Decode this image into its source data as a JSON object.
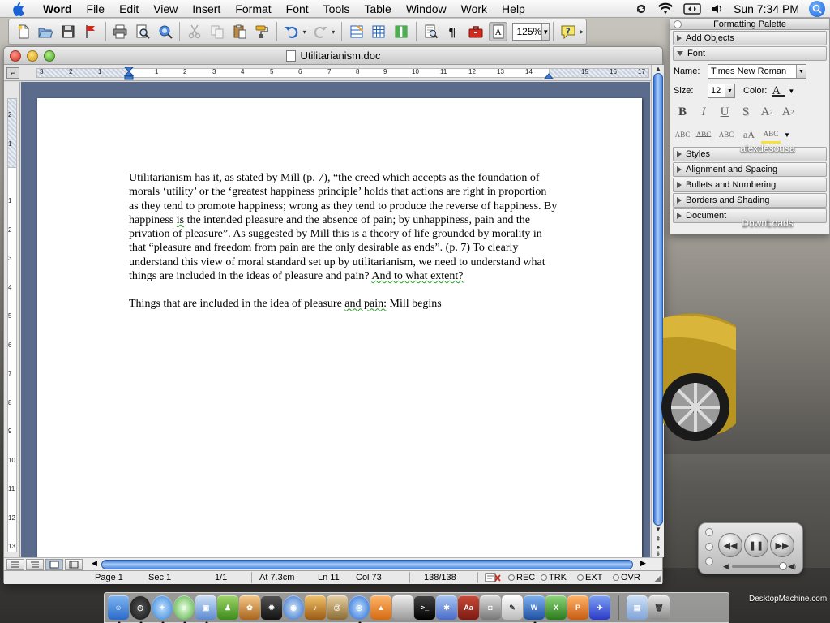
{
  "menubar": {
    "app_name": "Word",
    "menus": [
      "File",
      "Edit",
      "View",
      "Insert",
      "Format",
      "Font",
      "Tools",
      "Table",
      "Window",
      "Work",
      "Help"
    ],
    "clock": "Sun 7:34 PM",
    "icons": [
      "apple-icon",
      "sync-icon",
      "wifi-icon",
      "display-icon",
      "volume-icon",
      "spotlight-icon"
    ]
  },
  "toolbar": {
    "zoom": "125%",
    "icons": [
      "new-document-icon",
      "open-icon",
      "save-icon",
      "flag-icon",
      "print-icon",
      "print-preview-icon",
      "web-preview-icon",
      "cut-icon",
      "copy-icon",
      "paste-icon",
      "format-painter-icon",
      "undo-icon",
      "redo-icon",
      "tables-borders-icon",
      "insert-table-icon",
      "columns-icon",
      "document-map-icon",
      "show-formatting-icon",
      "toolbox-icon",
      "formatting-palette-icon",
      "help-icon",
      "more-icon"
    ]
  },
  "window": {
    "title": "Utilitarianism.doc",
    "ruler_h": [
      "3",
      "2",
      "1",
      "1",
      "2",
      "3",
      "4",
      "5",
      "6",
      "7",
      "8",
      "9",
      "10",
      "11",
      "12",
      "13",
      "14",
      "15",
      "16",
      "17"
    ],
    "ruler_v": [
      "2",
      "1",
      "1",
      "2",
      "3",
      "4",
      "5",
      "6",
      "7",
      "8",
      "9",
      "10",
      "11",
      "12",
      "13"
    ]
  },
  "document": {
    "paragraph1_parts": [
      "Utilitarianism has it, as stated by Mill (p. 7), “the creed which accepts as the foundation of morals ‘utility’ or the ‘greatest happiness principle’ holds that actions are right in proportion as they tend to promote happiness; wrong as they tend to produce the reverse of happiness. By happiness ",
      "is",
      " the intended pleasure and the absence of pain; by unhappiness, pain and the privation of pleasure”. As suggested by Mill this is a theory of life grounded by morality in that “pleasure and freedom from pain are the only desirable as ends”. (p. 7) To clearly understand this view of moral standard set up by utilitarianism, we need to understand what things are included in the ideas of pleasure and pain? ",
      "And to what extent?"
    ],
    "paragraph2_parts": [
      "Things that are included in the idea of pleasure ",
      "and  pain:",
      " Mill begins"
    ]
  },
  "statusbar": {
    "page": "Page  1",
    "sec": "Sec  1",
    "pages": "1/1",
    "at": "At  7.3cm",
    "ln": "Ln  11",
    "col": "Col  73",
    "words": "138/138",
    "modes": [
      "REC",
      "TRK",
      "EXT",
      "OVR"
    ]
  },
  "palette": {
    "title": "Formatting Palette",
    "sections_top": [
      "Add Objects",
      "Font"
    ],
    "font_name_label": "Name:",
    "font_name": "Times New Roman",
    "size_label": "Size:",
    "size": "12",
    "color_label": "Color:",
    "sections_bottom": [
      "Styles",
      "Alignment and Spacing",
      "Bullets and Numbering",
      "Borders and Shading",
      "Document"
    ]
  },
  "desktop": {
    "icons": [
      "alexdesousa",
      "DownLoads"
    ],
    "watermark": "DesktopMachine.com"
  },
  "dock": {
    "apps": [
      "Finder",
      "Dashboard",
      "Safari",
      "iTunes",
      "Preview",
      "Automator",
      "iPhoto",
      "iMovie",
      "iDVD",
      "GarageBand",
      "Address Book",
      "Spotlight",
      "VLC",
      "Apple",
      "Terminal",
      "Grapher",
      "Dictionary",
      "Image Capture",
      "TextEdit",
      "Word",
      "Excel",
      "PowerPoint",
      "Entourage",
      "Applications",
      "Trash"
    ]
  },
  "colors": {
    "selection_blue": "#3d78d3",
    "page_bg": "#5a6b8c",
    "spellcheck": "#2a9d2a"
  }
}
